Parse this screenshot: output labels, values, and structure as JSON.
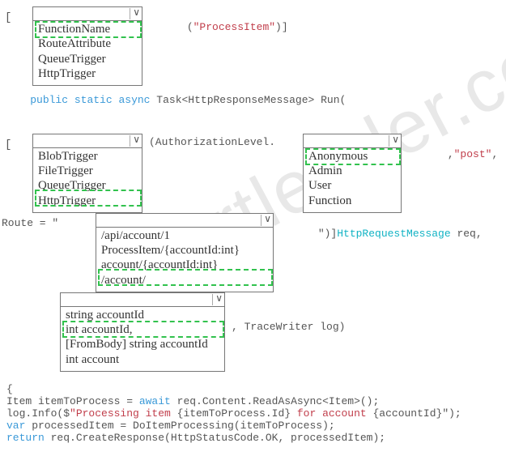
{
  "watermark": "certleader.com",
  "row1": {
    "prefix": "[",
    "options": [
      "FunctionName",
      "RouteAttribute",
      "QueueTrigger",
      "HttpTrigger"
    ],
    "after_open": "(",
    "literal": "\"ProcessItem\"",
    "after_close": ")]",
    "highlight_index": 0
  },
  "signature": {
    "kw1": "public",
    "kw2": "static",
    "kw3": "async",
    "rest": " Task<HttpResponseMessage> Run("
  },
  "row2": {
    "prefix": "[",
    "left_options": [
      "BlobTrigger",
      "FileTrigger",
      "QueueTrigger",
      "HttpTrigger"
    ],
    "left_highlight_index": 3,
    "mid_text": "(AuthorizationLevel.",
    "right_options": [
      "Anonymous",
      "Admin",
      "User",
      "Function"
    ],
    "right_highlight_index": 0,
    "after_comma": ",",
    "literal": "\"post\"",
    "after_close": ","
  },
  "row3": {
    "prefix": "Route = \"",
    "options": [
      "/api/account/1",
      "ProcessItem/{accountId:int}",
      "account/{accountId:int}",
      "/account/"
    ],
    "highlight_index": 3,
    "after_quote_close": "\")]",
    "req_type": "HttpRequestMessage",
    "req_rest": " req,"
  },
  "row4": {
    "options": [
      "string accountId",
      "int accountId,",
      "[FromBody] string accountId",
      "int account"
    ],
    "highlight_index": 1,
    "after": ", TraceWriter log)"
  },
  "code": {
    "open_brace": "{",
    "l1a": "Item itemToProcess = ",
    "l1_kw": "await",
    "l1b": " req.Content.ReadAsAsync<Item>();",
    "l2a": "log.Info($",
    "l2_str1": "\"Processing item ",
    "l2_mid": "{itemToProcess.Id}",
    "l2_kw": " for account ",
    "l2_end": "{accountId}\"",
    "l2_close": ");",
    "l3_kw": "var",
    "l3_rest": " processedItem = DoItemProcessing(itemToProcess);",
    "l4_kw": "return",
    "l4_rest": " req.CreateResponse(HttpStatusCode.OK, processedItem);"
  }
}
